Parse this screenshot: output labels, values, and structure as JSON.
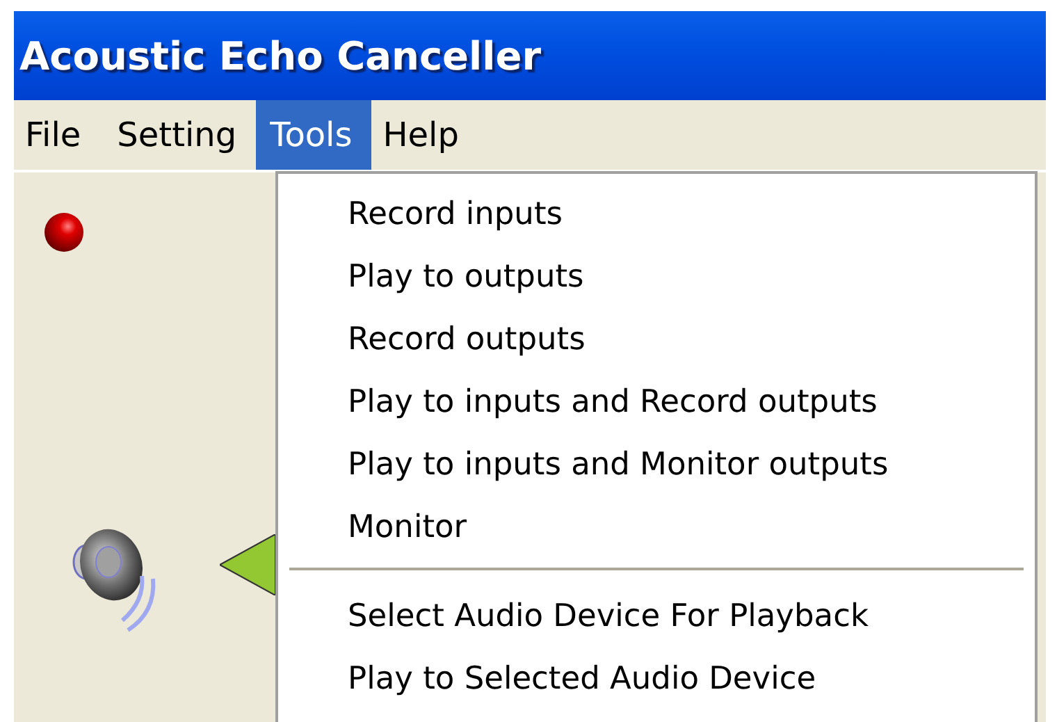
{
  "window": {
    "title": "Acoustic Echo Canceller"
  },
  "menu_bar": [
    {
      "label": "File",
      "selected": false
    },
    {
      "label": "Setting",
      "selected": false
    },
    {
      "label": "Tools",
      "selected": true
    },
    {
      "label": "Help",
      "selected": false
    }
  ],
  "tools_menu": [
    {
      "kind": "item",
      "label": "Record inputs"
    },
    {
      "kind": "item",
      "label": "Play to outputs"
    },
    {
      "kind": "item",
      "label": "Record outputs"
    },
    {
      "kind": "item",
      "label": "Play to inputs and Record outputs"
    },
    {
      "kind": "item",
      "label": "Play to inputs and Monitor outputs"
    },
    {
      "kind": "item",
      "label": "Monitor"
    },
    {
      "kind": "separator"
    },
    {
      "kind": "item",
      "label": "Select Audio Device For Playback"
    },
    {
      "kind": "item",
      "label": "Play to Selected Audio Device"
    }
  ]
}
